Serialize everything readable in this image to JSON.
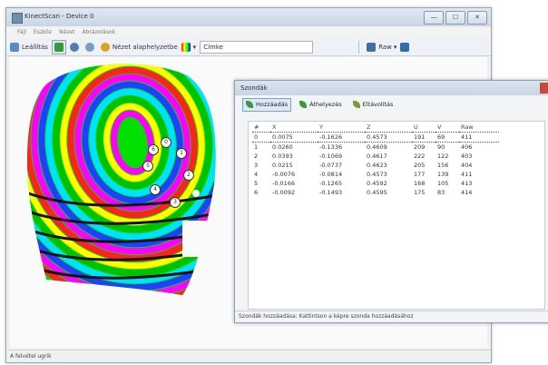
{
  "window": {
    "title": "KinectScan - Device 0",
    "controls": [
      "—",
      "☐",
      "✕"
    ]
  },
  "menu": [
    "Fájl",
    "Eszköz",
    "Nézet",
    "Ábrázolások"
  ],
  "toolbar": {
    "button1_label": "Leállítás",
    "button2_label": "Nézet alaphelyzetbe",
    "combo_value": "Címke",
    "raw_label": "Raw",
    "dropdown_glyph": "▾"
  },
  "status": "A felvétel ugrik",
  "dialog": {
    "title": "Szondák",
    "tabs": [
      {
        "label": "Hozzáadás",
        "active": true
      },
      {
        "label": "Áthelyezés",
        "active": false
      },
      {
        "label": "Eltávolítás",
        "active": false
      }
    ],
    "columns": [
      "#",
      "X",
      "Y",
      "Z",
      "U",
      "V",
      "Raw"
    ],
    "rows": [
      [
        "0",
        "0.0075",
        "-0.1626",
        "0.4573",
        "191",
        "69",
        "411"
      ],
      [
        "1",
        "0.0260",
        "-0.1336",
        "0.4609",
        "209",
        "90",
        "406"
      ],
      [
        "2",
        "0.0393",
        "-0.1069",
        "0.4617",
        "222",
        "122",
        "403"
      ],
      [
        "3",
        "0.0215",
        "-0.0737",
        "0.4623",
        "205",
        "156",
        "404"
      ],
      [
        "4",
        "-0.0076",
        "-0.0814",
        "0.4573",
        "177",
        "139",
        "411"
      ],
      [
        "5",
        "-0.0166",
        "-0.1265",
        "0.4592",
        "168",
        "105",
        "413"
      ],
      [
        "6",
        "-0.0092",
        "-0.1493",
        "0.4595",
        "175",
        "83",
        "414"
      ]
    ],
    "status": "Szondák hozzáadása: Kattintson a képre szonda hozzáadásához"
  },
  "markers": [
    "0",
    "1",
    "2",
    "3",
    "4",
    "5",
    "6"
  ],
  "colors": {
    "accent": "#dbe9f6",
    "close": "#c94a3a"
  }
}
